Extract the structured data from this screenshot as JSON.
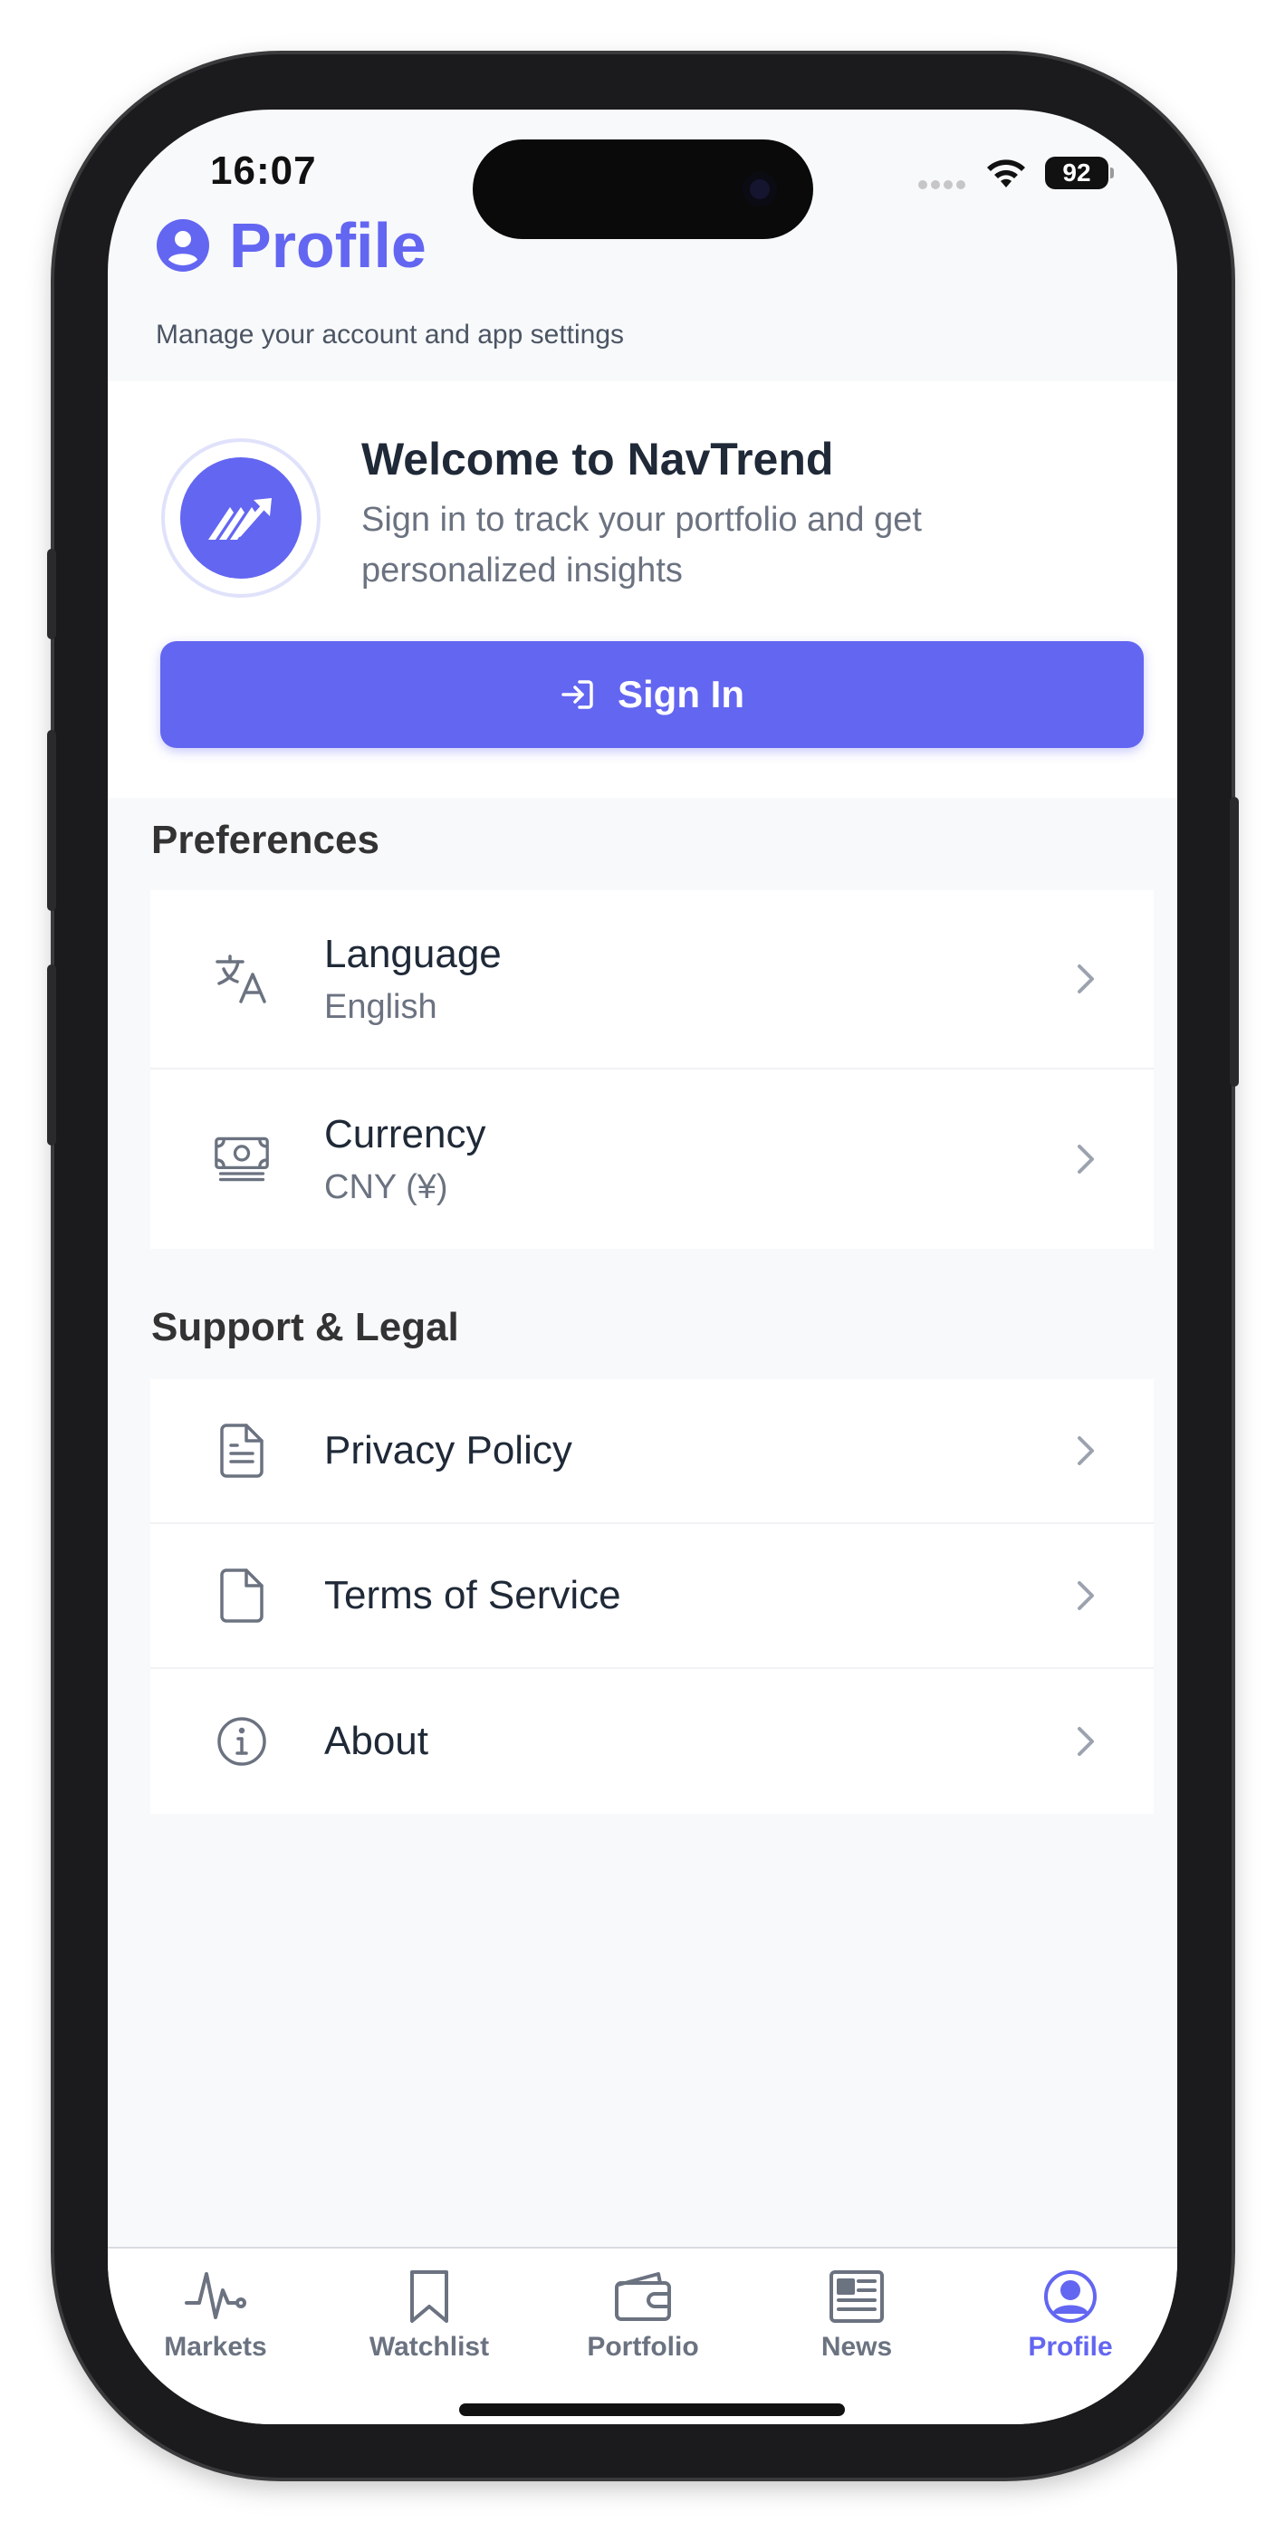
{
  "status_bar": {
    "time": "16:07",
    "battery": "92"
  },
  "header": {
    "title": "Profile",
    "subtitle": "Manage your account and app settings"
  },
  "welcome": {
    "title": "Welcome to NavTrend",
    "text": "Sign in to track your portfolio and get personalized insights",
    "sign_in_label": "Sign In"
  },
  "preferences": {
    "title": "Preferences",
    "items": [
      {
        "label": "Language",
        "value": "English",
        "icon": "translate-icon"
      },
      {
        "label": "Currency",
        "value": "CNY (¥)",
        "icon": "banknote-icon"
      }
    ]
  },
  "support": {
    "title": "Support & Legal",
    "items": [
      {
        "label": "Privacy Policy",
        "icon": "document-text-icon"
      },
      {
        "label": "Terms of Service",
        "icon": "document-icon"
      },
      {
        "label": "About",
        "icon": "info-circle-icon"
      }
    ]
  },
  "tabs": [
    {
      "label": "Markets",
      "icon": "pulse-icon",
      "active": false
    },
    {
      "label": "Watchlist",
      "icon": "bookmark-icon",
      "active": false
    },
    {
      "label": "Portfolio",
      "icon": "wallet-icon",
      "active": false
    },
    {
      "label": "News",
      "icon": "newspaper-icon",
      "active": false
    },
    {
      "label": "Profile",
      "icon": "user-circle-icon",
      "active": true
    }
  ],
  "colors": {
    "accent": "#6366f1",
    "text": "#1f2937",
    "muted": "#6b7280",
    "background": "#f8f9fb"
  }
}
